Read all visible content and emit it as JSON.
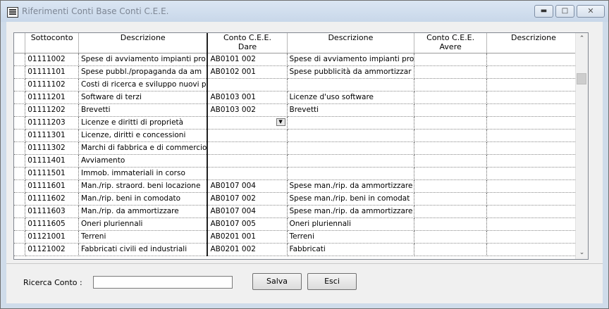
{
  "window": {
    "title": "Riferimenti Conti Base Conti C.E.E."
  },
  "grid": {
    "headers": {
      "sottoconto": "Sottoconto",
      "descrizione": "Descrizione",
      "dare_1": "Conto C.E.E.",
      "dare_2": "Dare",
      "desc_dare": "Descrizione",
      "avere_1": "Conto C.E.E.",
      "avere_2": "Avere",
      "desc_avere": "Descrizione"
    },
    "rows": [
      {
        "sottoconto": "01111002",
        "descrizione": "Spese di avviamento impianti pro",
        "dare": "AB0101   002",
        "desc_dare": "Spese di avviamento impianti pro",
        "avere": "",
        "desc_avere": ""
      },
      {
        "sottoconto": "01111101",
        "descrizione": "Spese pubbl./propaganda da am",
        "dare": "AB0102   001",
        "desc_dare": "Spese pubblicità da ammortizzar",
        "avere": "",
        "desc_avere": ""
      },
      {
        "sottoconto": "01111102",
        "descrizione": "Costi di ricerca e sviluppo nuovi p",
        "dare": "",
        "desc_dare": "",
        "avere": "",
        "desc_avere": ""
      },
      {
        "sottoconto": "01111201",
        "descrizione": "Software di terzi",
        "dare": "AB0103   001",
        "desc_dare": "Licenze d'uso software",
        "avere": "",
        "desc_avere": ""
      },
      {
        "sottoconto": "01111202",
        "descrizione": "Brevetti",
        "dare": "AB0103   002",
        "desc_dare": "Brevetti",
        "avere": "",
        "desc_avere": ""
      },
      {
        "sottoconto": "01111203",
        "descrizione": "Licenze e diritti di proprietà",
        "dare": "",
        "desc_dare": "",
        "avere": "",
        "desc_avere": ""
      },
      {
        "sottoconto": "01111301",
        "descrizione": "Licenze, diritti e concessioni",
        "dare": "",
        "desc_dare": "",
        "avere": "",
        "desc_avere": ""
      },
      {
        "sottoconto": "01111302",
        "descrizione": "Marchi di fabbrica e di commercio",
        "dare": "",
        "desc_dare": "",
        "avere": "",
        "desc_avere": ""
      },
      {
        "sottoconto": "01111401",
        "descrizione": "Avviamento",
        "dare": "",
        "desc_dare": "",
        "avere": "",
        "desc_avere": ""
      },
      {
        "sottoconto": "01111501",
        "descrizione": "Immob. immateriali in corso",
        "dare": "",
        "desc_dare": "",
        "avere": "",
        "desc_avere": ""
      },
      {
        "sottoconto": "01111601",
        "descrizione": "Man./rip. straord. beni locazione",
        "dare": "AB0107   004",
        "desc_dare": "Spese man./rip. da ammortizzare",
        "avere": "",
        "desc_avere": ""
      },
      {
        "sottoconto": "01111602",
        "descrizione": "Man./rip. beni in comodato",
        "dare": "AB0107   002",
        "desc_dare": "Spese man./rip. beni in comodat",
        "avere": "",
        "desc_avere": ""
      },
      {
        "sottoconto": "01111603",
        "descrizione": "Man./rip. da ammortizzare",
        "dare": "AB0107   004",
        "desc_dare": "Spese man./rip. da ammortizzare",
        "avere": "",
        "desc_avere": ""
      },
      {
        "sottoconto": "01111605",
        "descrizione": "Oneri pluriennali",
        "dare": "AB0107   005",
        "desc_dare": "Oneri pluriennali",
        "avere": "",
        "desc_avere": ""
      },
      {
        "sottoconto": "01121001",
        "descrizione": "Terreni",
        "dare": "AB0201   001",
        "desc_dare": "Terreni",
        "avere": "",
        "desc_avere": ""
      },
      {
        "sottoconto": "01121002",
        "descrizione": "Fabbricati civili ed industriali",
        "dare": "AB0201   002",
        "desc_dare": "Fabbricati",
        "avere": "",
        "desc_avere": ""
      }
    ]
  },
  "footer": {
    "search_label": "Ricerca Conto :",
    "search_value": "",
    "save_label": "Salva",
    "exit_label": "Esci"
  }
}
